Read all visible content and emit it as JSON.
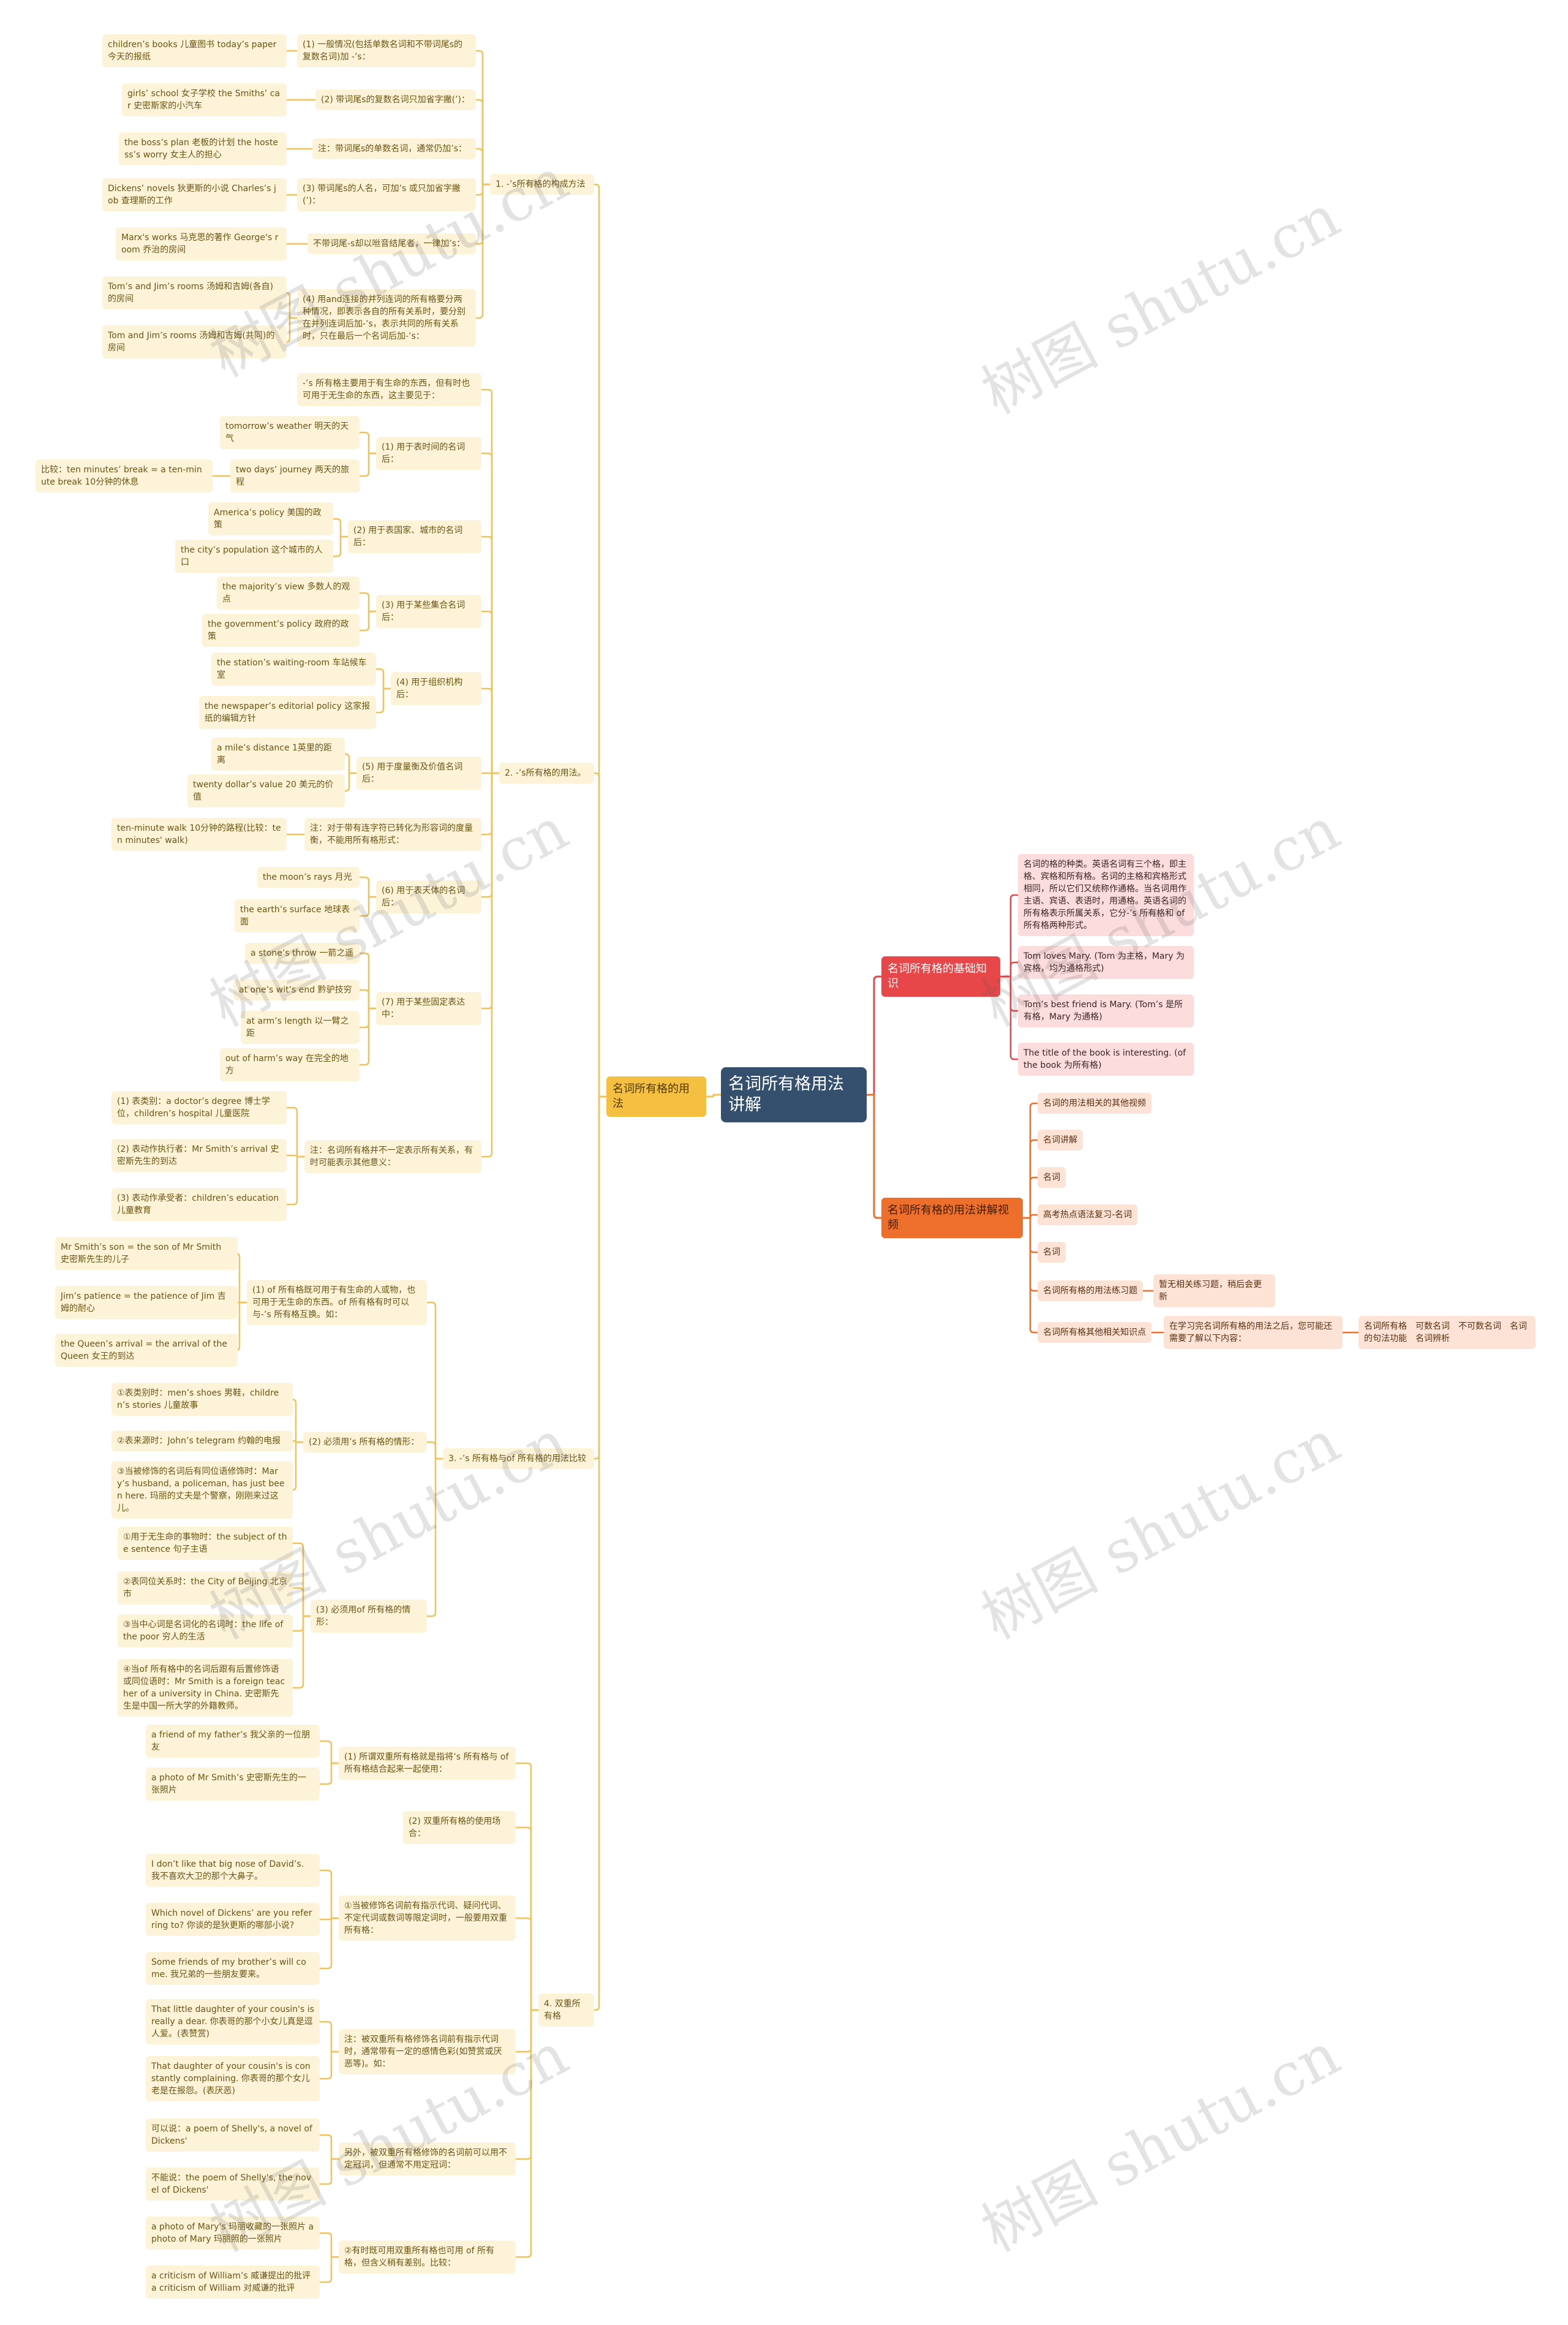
{
  "root": "名词所有格用法讲解",
  "watermark": "树图 shutu.cn",
  "colors": {
    "root": "#34506e",
    "usage": "#f5c042",
    "basics": "#e8474a",
    "videos": "#ee6e2b",
    "usage_line": "#f0c259"
  },
  "usage": {
    "label": "名词所有格的用法",
    "sections": [
      {
        "label": "1. -’s所有格的构成方法",
        "items": [
          {
            "label": "(1) 一般情况(包括单数名词和不带词尾s的复数名词)加 -’s：",
            "examples": [
              "children’s books 儿童图书 today’s paper 今天的报纸"
            ]
          },
          {
            "label": "(2) 带词尾s的复数名词只加省字撇(’)：",
            "examples": [
              "girls’ school 女子学校 the Smiths’ car 史密斯家的小汽车"
            ]
          },
          {
            "label": "注：带词尾s的单数名词，通常仍加’s：",
            "examples": [
              "the boss’s plan 老板的计划 the hostess’s worry 女主人的担心"
            ]
          },
          {
            "label": "(3) 带词尾s的人名，可加’s 或只加省字撇(’)：",
            "examples": [
              "Dickens’ novels 狄更斯的小说 Charles’s job 查理斯的工作"
            ]
          },
          {
            "label": "不带词尾-s却以咝音结尾者，一律加’s：",
            "examples": [
              "Marx's works 马克思的著作 George's room 乔治的房间"
            ]
          },
          {
            "label": "(4) 用and连接的并列连词的所有格要分两种情况，即表示各自的所有关系时，要分别在并列连词后加-’s，表示共同的所有关系时，只在最后一个名词后加-’s：",
            "examples": [
              "Tom’s and Jim’s rooms 汤姆和吉姆(各自)的房间",
              "Tom and Jim’s rooms 汤姆和吉姆(共同)的房间"
            ]
          }
        ]
      },
      {
        "label": "2. -’s所有格的用法。",
        "items": [
          {
            "label": "-’s 所有格主要用于有生命的东西，但有时也可用于无生命的东西，这主要见于：",
            "examples": []
          },
          {
            "label": "(1) 用于表时间的名词后：",
            "examples": [
              "tomorrow’s weather 明天的天气",
              "two days’ journey 两天的旅程"
            ],
            "compare": "比较：ten minutes’ break = a ten-minute break 10分钟的休息"
          },
          {
            "label": "(2) 用于表国家、城市的名词后：",
            "examples": [
              "America’s policy 美国的政策",
              "the city’s population 这个城市的人口"
            ]
          },
          {
            "label": "(3) 用于某些集合名词后：",
            "examples": [
              "the majority’s view 多数人的观点",
              "the government’s policy 政府的政策"
            ]
          },
          {
            "label": "(4) 用于组织机构后：",
            "examples": [
              "the station’s waiting-room 车站候车室",
              "the newspaper’s editorial policy 这家报纸的编辑方针"
            ]
          },
          {
            "label": "(5) 用于度量衡及价值名词后：",
            "examples": [
              "a mile’s distance 1英里的距离",
              "twenty dollar’s value 20 美元的价值"
            ]
          },
          {
            "label": "注：对于带有连字符已转化为形容词的度量衡，不能用所有格形式：",
            "examples": [
              "ten-minute walk 10分钟的路程(比较：ten minutes' walk)"
            ]
          },
          {
            "label": "(6) 用于表天体的名词后：",
            "examples": [
              "the moon’s rays 月光",
              "the earth’s surface 地球表面"
            ]
          },
          {
            "label": "(7) 用于某些固定表达中：",
            "examples": [
              "a stone’s throw 一箭之遥",
              "at one’s wit’s end 黔驴技穷",
              "at arm’s length 以一臂之距",
              "out of harm’s way 在完全的地方"
            ]
          },
          {
            "label": "注：名词所有格并不一定表示所有关系，有时可能表示其他意义：",
            "examples": [
              "(1) 表类别：a doctor’s degree 博士学位，children’s hospital 儿童医院",
              "(2) 表动作执行者：Mr Smith’s arrival 史密斯先生的到达",
              "(3) 表动作承受者：children’s education 儿童教育"
            ]
          }
        ]
      },
      {
        "label": "3. -’s 所有格与of 所有格的用法比较",
        "items": [
          {
            "label": "(1) of 所有格既可用于有生命的人或物，也可用于无生命的东西。of 所有格有时可以与-’s 所有格互换。如：",
            "examples": [
              "Mr Smith’s son = the son of Mr Smith 史密斯先生的儿子",
              "Jim’s patience = the patience of Jim 吉姆的耐心",
              "the Queen’s arrival = the arrival of the Queen 女王的到达"
            ]
          },
          {
            "label": "(2) 必须用’s 所有格的情形：",
            "examples": [
              "①表类别时：men’s shoes 男鞋，children’s stories 儿童故事",
              "②表来源时：John’s telegram 约翰的电报",
              "③当被修饰的名词后有同位语修饰时：Mary’s husband, a policeman, has just been here. 玛丽的丈夫是个警察，刚刚来过这儿。"
            ]
          },
          {
            "label": "(3) 必须用of 所有格的情形：",
            "examples": [
              "①用于无生命的事物时：the subject of the sentence 句子主语",
              "②表同位关系时：the City of Beijing 北京市",
              "③当中心词是名词化的名词时：the life of the poor 穷人的生活",
              "④当of 所有格中的名词后跟有后置修饰语或同位语时：Mr Smith is a foreign teacher of a university in China. 史密斯先生是中国一所大学的外籍教师。"
            ]
          }
        ]
      },
      {
        "label": "4. 双重所有格",
        "items": [
          {
            "label": "(1) 所谓双重所有格就是指将’s 所有格与 of 所有格结合起来一起使用：",
            "examples": [
              "a friend of my father’s 我父亲的一位朋友",
              "a photo of Mr Smith’s 史密斯先生的一张照片"
            ]
          },
          {
            "label": "(2) 双重所有格的使用场合：",
            "examples": []
          },
          {
            "label": "①当被修饰名词前有指示代词、疑问代词、不定代词或数词等限定词时，一般要用双重所有格：",
            "examples": [
              "I don’t like that big nose of David’s. 我不喜欢大卫的那个大鼻子。",
              "Which novel of Dickens’ are you referring to? 你谈的是狄更斯的哪部小说?",
              "Some friends of my brother’s will come. 我兄弟的一些朋友要来。"
            ]
          },
          {
            "label": "注：被双重所有格修饰名词前有指示代词时，通常带有一定的感情色彩(如赞赏或厌恶等)。如：",
            "examples": [
              "That little daughter of your cousin's is really a dear. 你表哥的那个小女儿真是逗人爱。(表赞赏)",
              "That daughter of your cousin's is constantly complaining. 你表哥的那个女儿老是在报怨。(表厌恶)"
            ]
          },
          {
            "label": "另外，被双重所有格修饰的名词前可以用不定冠词，但通常不用定冠词：",
            "examples": [
              "可以说：a poem of Shelly's, a novel of Dickens'",
              "不能说：the poem of Shelly's, the novel of Dickens'"
            ]
          },
          {
            "label": "②有时既可用双重所有格也可用 of 所有格，但含义稍有差别。比较：",
            "examples": [
              "a photo of Mary's 玛丽收藏的一张照片 a photo of Mary 玛丽照的一张照片",
              "a criticism of William’s 威谦提出的批评 a criticism of William 对威谦的批评"
            ]
          }
        ]
      }
    ]
  },
  "basics": {
    "label": "名词所有格的基础知识",
    "items": [
      "名词的格的种类。英语名词有三个格，即主格、宾格和所有格。名词的主格和宾格形式相同，所以它们又统称作通格。当名词用作主语、宾语、表语时，用通格。英语名词的所有格表示所属关系，它分-’s 所有格和 of 所有格两种形式。",
      "Tom loves Mary. (Tom 为主格，Mary 为宾格，均为通格形式)",
      "Tom’s best friend is Mary. (Tom’s 是所有格，Mary 为通格)",
      "The title of the book is interesting. (of the book 为所有格)"
    ]
  },
  "videos": {
    "label": "名词所有格的用法讲解视频",
    "items": [
      {
        "label": "名词的用法相关的其他视频"
      },
      {
        "label": "名词讲解"
      },
      {
        "label": "名词"
      },
      {
        "label": "高考热点语法复习-名词"
      },
      {
        "label": "名词"
      },
      {
        "label": "名词所有格的用法练习题",
        "child": "暂无相关练习题，稍后会更新"
      },
      {
        "label": "名词所有格其他相关知识点",
        "child": "在学习完名词所有格的用法之后，您可能还需要了解以下内容：",
        "grandchild": "名词所有格　可数名词　不可数名词　名词的句法功能　名词辨析"
      }
    ]
  }
}
